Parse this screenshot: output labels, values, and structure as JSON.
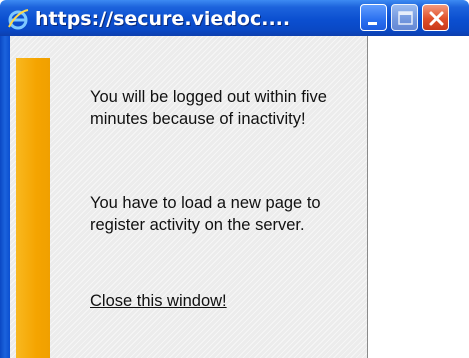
{
  "window": {
    "title": "https://secure.viedoc....",
    "icon": "internet-explorer-icon",
    "controls": {
      "minimize": "minimize-icon",
      "maximize": "maximize-icon",
      "close": "close-icon"
    }
  },
  "message": {
    "paragraph1": "You will be logged out within five minutes because of inactivity!",
    "paragraph2": "You have to load a new page to register activity on the server."
  },
  "actions": {
    "close_link": "Close this window!"
  },
  "colors": {
    "titlebar": "#0b4fd0",
    "accent_bar": "#f5a400",
    "close_button": "#e0502a"
  }
}
